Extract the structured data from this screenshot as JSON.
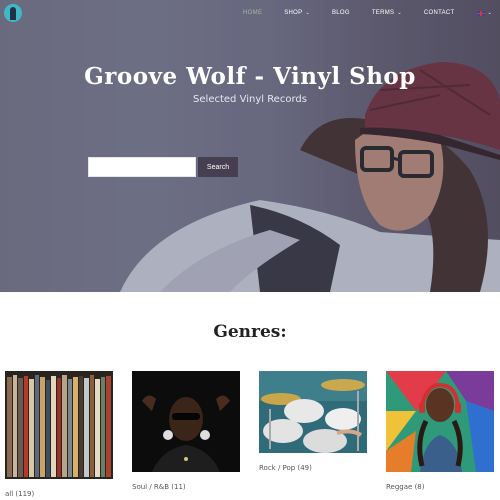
{
  "nav": {
    "logo": "wolf-logo-icon",
    "items": [
      {
        "label": "HOME",
        "active": true,
        "dropdown": false
      },
      {
        "label": "SHOP",
        "active": false,
        "dropdown": true
      },
      {
        "label": "BLOG",
        "active": false,
        "dropdown": false
      },
      {
        "label": "TERMS",
        "active": false,
        "dropdown": true
      },
      {
        "label": "CONTACT",
        "active": false,
        "dropdown": false
      }
    ],
    "language": "uk-flag-icon"
  },
  "hero": {
    "title": "Groove Wolf - Vinyl Shop",
    "subtitle": "Selected Vinyl Records",
    "search": {
      "placeholder": "",
      "value": "",
      "button_label": "Search"
    },
    "accent": "#463f52"
  },
  "genres": {
    "heading": "Genres:",
    "items": [
      {
        "label": "all (119)"
      },
      {
        "label": "Soul / R&B (11)"
      },
      {
        "label": "Rock / Pop (49)"
      },
      {
        "label": "Reggae (8)"
      }
    ]
  }
}
